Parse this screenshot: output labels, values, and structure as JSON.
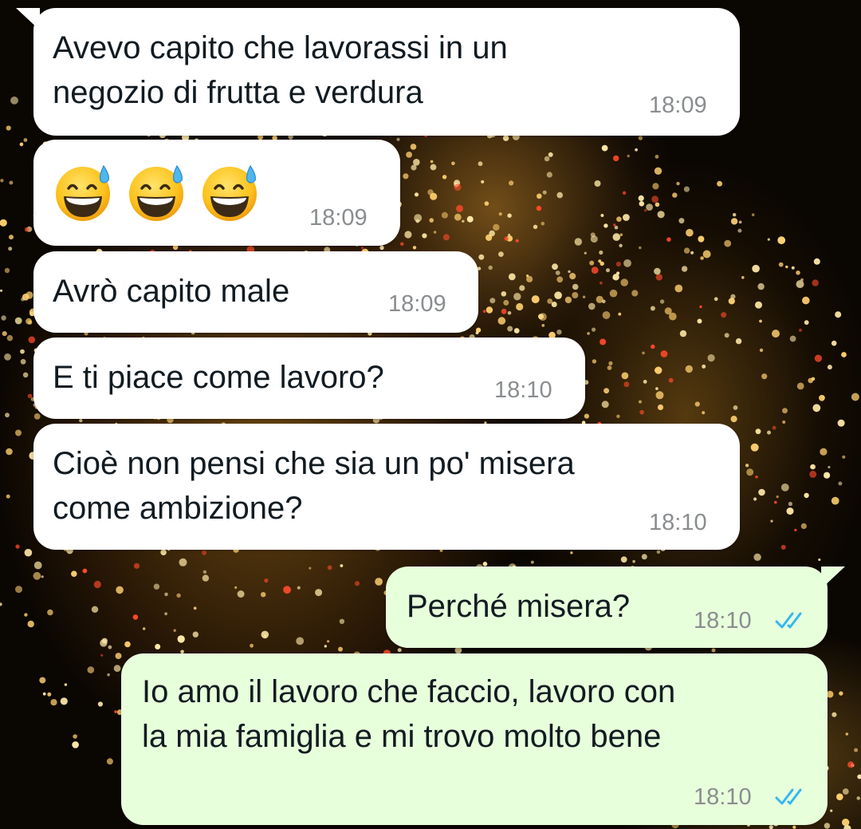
{
  "chat": {
    "messages": [
      {
        "direction": "incoming",
        "text": "Avevo capito che lavorassi in un\nnegozio di frutta e verdura",
        "time": "18:09"
      },
      {
        "direction": "incoming",
        "emoji": [
          "grinning-face-with-sweat",
          "grinning-face-with-sweat",
          "grinning-face-with-sweat"
        ],
        "time": "18:09"
      },
      {
        "direction": "incoming",
        "text": "Avrò capito male",
        "time": "18:09"
      },
      {
        "direction": "incoming",
        "text": "E ti piace come lavoro?",
        "time": "18:10"
      },
      {
        "direction": "incoming",
        "text": "Cioè non pensi che sia un po' misera\ncome ambizione?",
        "time": "18:10"
      },
      {
        "direction": "outgoing",
        "text": "Perché misera?",
        "time": "18:10",
        "status": "read"
      },
      {
        "direction": "outgoing",
        "text": "Io amo il lavoro che faccio, lavoro con\nla mia famiglia e mi trovo molto bene",
        "time": "18:10",
        "status": "read"
      }
    ]
  },
  "colors": {
    "incoming_bubble": "#ffffff",
    "outgoing_bubble": "#e7ffdb",
    "read_ticks": "#34b7f1",
    "timestamp": "#8a8d8f"
  },
  "icons": {
    "read_receipt": "double-check-icon",
    "emoji": "grinning-face-with-sweat-emoji"
  }
}
